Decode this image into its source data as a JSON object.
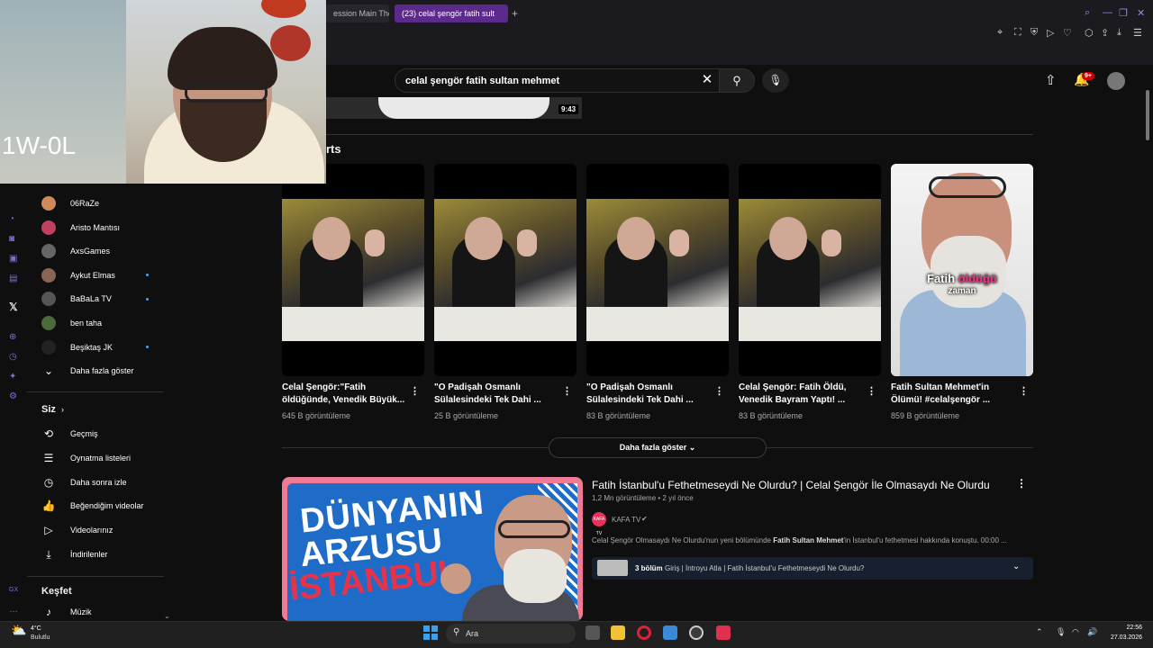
{
  "browser": {
    "tabs": [
      {
        "label": "ession Main Ther"
      },
      {
        "label": "(23) celal şengör fatih sult"
      }
    ],
    "new_tab": "+"
  },
  "webcam": {
    "score": "1W-0L"
  },
  "header": {
    "search_value": "celal şengör fatih sultan mehmet",
    "notification_count": "9+"
  },
  "top_video": {
    "duration": "9:43"
  },
  "shorts": {
    "section_title": "rts",
    "items": [
      {
        "title": "Celal Şengör:\"Fatih öldüğünde, Venedik Büyük...",
        "views": "645 B görüntüleme"
      },
      {
        "title": "\"O Padişah Osmanlı Sülalesindeki Tek Dahi ...",
        "views": "25 B görüntüleme"
      },
      {
        "title": "\"O Padişah Osmanlı Sülalesindeki Tek Dahi ...",
        "views": "83 B görüntüleme"
      },
      {
        "title": "Celal Şengör: Fatih Öldü, Venedik Bayram Yaptı! ...",
        "views": "83 B görüntüleme"
      },
      {
        "title": "Fatih Sultan Mehmet'in Ölümü! #celalşengör ...",
        "views": "859 B görüntüleme",
        "caption_hl": "öldüğü",
        "caption_pre": "Fatih ",
        "caption_2": "zaman"
      }
    ],
    "more_label": "Daha fazla göster"
  },
  "sidebar": {
    "subscriptions": [
      {
        "name": "06RaZe",
        "color": "#d08a5a",
        "dot": false
      },
      {
        "name": "Aristo Mantısı",
        "color": "#c04060",
        "dot": false
      },
      {
        "name": "AxsGames",
        "color": "#666666",
        "dot": false
      },
      {
        "name": "Aykut Elmas",
        "color": "#886655",
        "dot": true
      },
      {
        "name": "BaBaLa TV",
        "color": "#555555",
        "dot": true
      },
      {
        "name": "ben taha",
        "color": "#4a6a3a",
        "dot": false
      },
      {
        "name": "Beşiktaş JK",
        "color": "#222222",
        "dot": true
      }
    ],
    "show_more": "Daha fazla göster",
    "you_title": "Siz",
    "you_items": [
      {
        "label": "Geçmiş",
        "icon": "history-icon"
      },
      {
        "label": "Oynatma listeleri",
        "icon": "playlist-icon"
      },
      {
        "label": "Daha sonra izle",
        "icon": "clock-icon"
      },
      {
        "label": "Beğendiğim videolar",
        "icon": "thumbs-up-icon"
      },
      {
        "label": "Videolarınız",
        "icon": "video-icon"
      },
      {
        "label": "İndirilenler",
        "icon": "download-icon"
      }
    ],
    "explore_title": "Keşfet",
    "explore_items": [
      {
        "label": "Müzik",
        "icon": "music-icon"
      }
    ],
    "rail_gx": "GX"
  },
  "video": {
    "title": "Fatih İstanbul'u Fethetmeseydi Ne Olurdu? | Celal Şengör İle Olmasaydı Ne Olurdu",
    "meta": "1,2 Mn görüntüleme • 2 yıl önce",
    "channel": "KAFA TV",
    "channel_avatar_text": "KAFA TV",
    "desc_a": "Celal Şengör",
    "desc_b": " Olmasaydı Ne Olurdu'nun yeni bölümünde ",
    "desc_c": "Fatih Sultan Mehmet",
    "desc_d": "'in İstanbul'u fethetmesi hakkında konuştu. 00:00 ...",
    "thumb_line1": "DÜNYANIN",
    "thumb_line2": "ARZUSU",
    "thumb_line3": "İSTANBUL",
    "chapters_count": "3 bölüm",
    "chapters_text": "Giriş | İntroyu Atla | Fatih İstanbul'u Fethetmeseydi Ne Olurdu?"
  },
  "taskbar": {
    "temp": "4°C",
    "weather": "Bulutlu",
    "search_label": "Ara",
    "time": "22:56",
    "date": "27.03.2026"
  },
  "colors": {
    "accent": "#3ea6ff",
    "opera": "#7f6fcf",
    "tab_active": "#5c2a8a"
  }
}
